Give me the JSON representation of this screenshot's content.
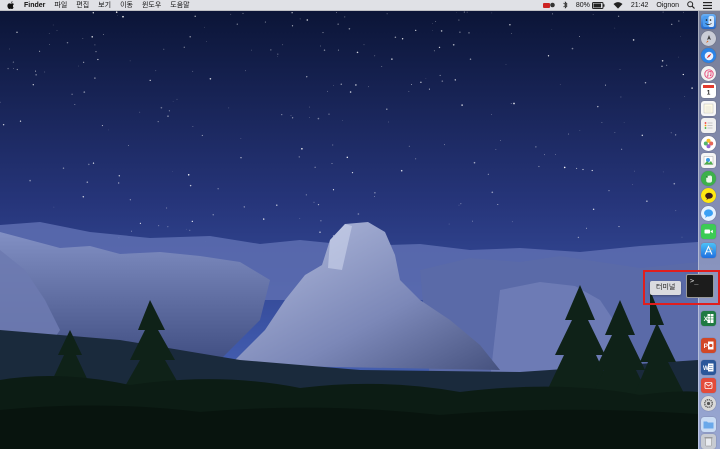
{
  "menubar": {
    "app_name": "Finder",
    "menus": [
      "파일",
      "편집",
      "보기",
      "이동",
      "윈도우",
      "도움말"
    ],
    "battery": "80%",
    "time": "21:42",
    "user": "Oignon"
  },
  "dock": {
    "tooltip": "터미널",
    "terminal_glyph": ">_"
  },
  "colors": {
    "highlight": "#e01e1e",
    "menubar_bg": "#ececf0",
    "sky_top": "#0c1538",
    "sky_bottom": "#3c4f9e"
  },
  "icons": [
    "apple-icon",
    "status-app-icon",
    "bluetooth-icon",
    "battery-icon",
    "wifi-icon",
    "spotlight-icon",
    "notification-icon"
  ]
}
